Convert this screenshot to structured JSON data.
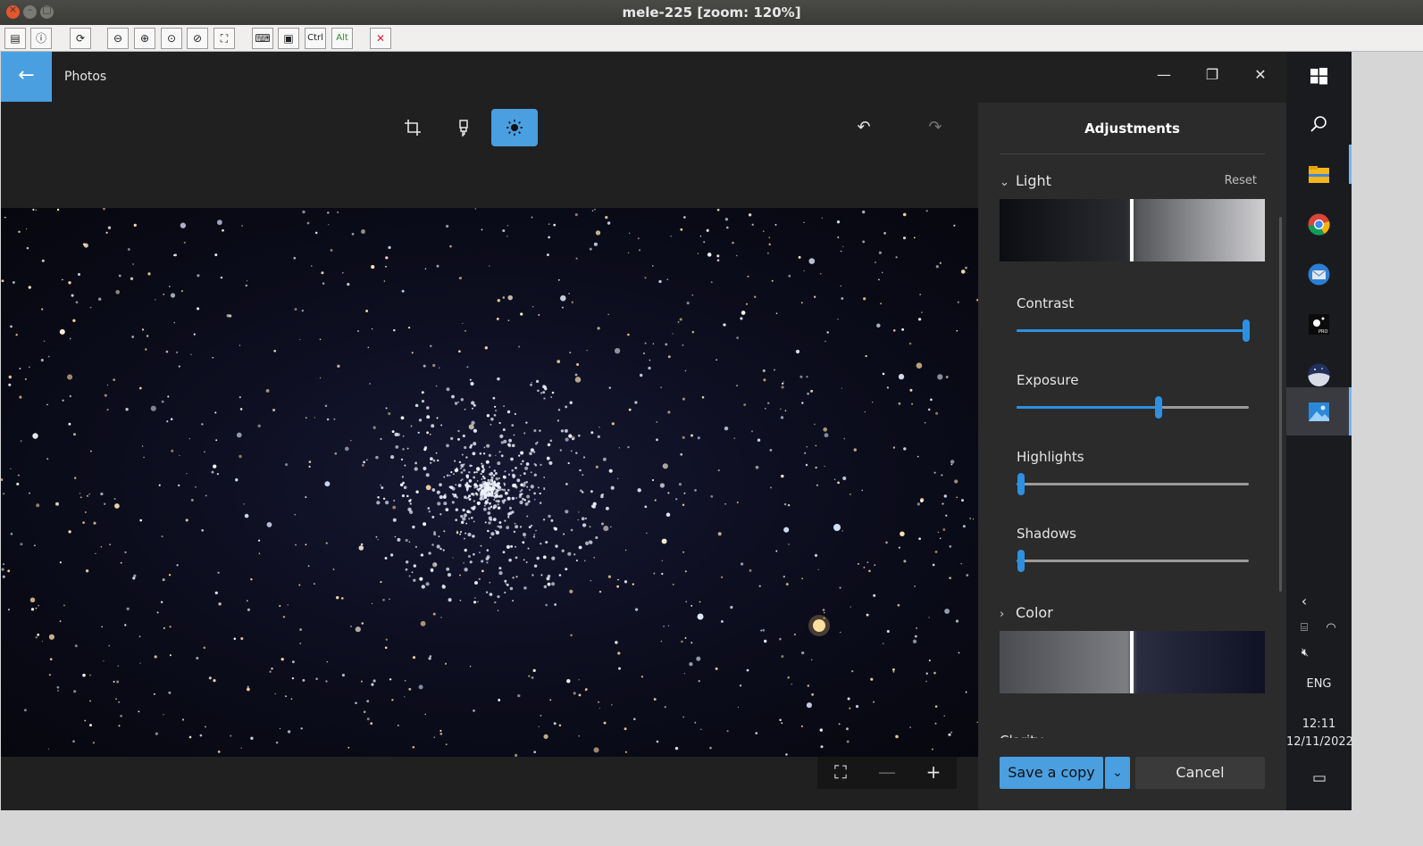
{
  "window": {
    "title": "mele-225 [zoom: 120%]"
  },
  "vnc_toolbar": {
    "ctrl_label": "Ctrl",
    "alt_label": "Alt"
  },
  "app": {
    "title": "Photos"
  },
  "panel": {
    "title": "Adjustments",
    "light": {
      "label": "Light",
      "reset_label": "Reset",
      "sliders": [
        {
          "label": "Contrast",
          "value": 0.99
        },
        {
          "label": "Exposure",
          "value": 0.61
        },
        {
          "label": "Highlights",
          "value": 0.02
        },
        {
          "label": "Shadows",
          "value": 0.02
        }
      ]
    },
    "color": {
      "label": "Color"
    },
    "clarity_label": "Clarity",
    "save_label": "Save a copy",
    "cancel_label": "Cancel"
  },
  "taskbar": {
    "language": "ENG",
    "time": "12:11",
    "date": "12/11/2022"
  },
  "colors": {
    "accent": "#4a9fe0",
    "slider_fill": "#2f8fe0",
    "panel_bg": "#2b2b2b",
    "app_bg": "#202020"
  }
}
